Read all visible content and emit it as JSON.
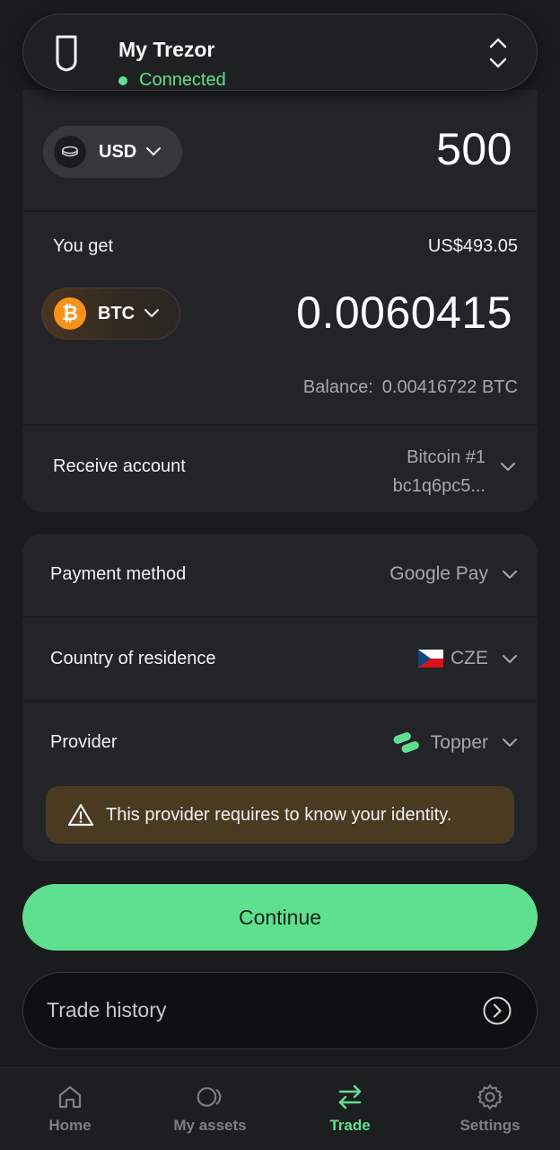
{
  "device": {
    "name": "My Trezor",
    "status": "Connected"
  },
  "buy": {
    "from_currency": "USD",
    "from_amount": "500",
    "you_get_label": "You get",
    "fiat_equivalent": "US$493.05",
    "to_currency": "BTC",
    "to_amount": "0.0060415",
    "balance_label": "Balance:",
    "balance_value": "0.00416722 BTC",
    "receive_account_label": "Receive account",
    "receive_account_name": "Bitcoin #1",
    "receive_account_address": "bc1q6pc5..."
  },
  "settings": {
    "payment_method_label": "Payment method",
    "payment_method_value": "Google Pay",
    "country_label": "Country of residence",
    "country_value": "CZE",
    "provider_label": "Provider",
    "provider_value": "Topper",
    "warning": "This provider requires to know your identity."
  },
  "continue_label": "Continue",
  "trade_history_label": "Trade history",
  "nav": {
    "items": [
      {
        "label": "Home",
        "icon": "home-icon"
      },
      {
        "label": "My assets",
        "icon": "assets-icon"
      },
      {
        "label": "Trade",
        "icon": "trade-icon",
        "active": true
      },
      {
        "label": "Settings",
        "icon": "gear-icon"
      }
    ]
  },
  "colors": {
    "accent": "#5fe090",
    "bitcoin": "#f7931a",
    "warning_bg": "#4a3a22"
  }
}
